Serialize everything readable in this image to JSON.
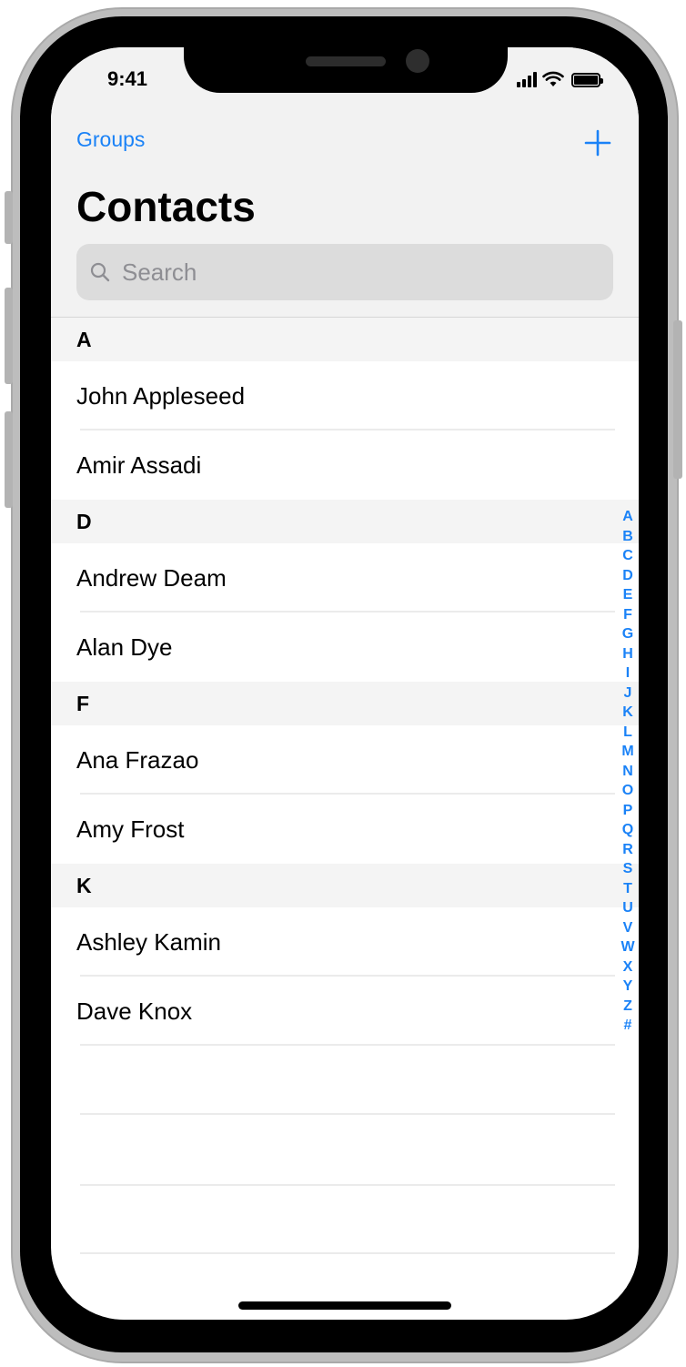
{
  "status_bar": {
    "time": "9:41"
  },
  "nav": {
    "left_label": "Groups",
    "title": "Contacts",
    "add_icon": "plus-icon"
  },
  "search": {
    "placeholder": "Search",
    "icon": "search-icon"
  },
  "sections": [
    {
      "letter": "A",
      "contacts": [
        "John Appleseed",
        "Amir Assadi"
      ]
    },
    {
      "letter": "D",
      "contacts": [
        "Andrew Deam",
        "Alan Dye"
      ]
    },
    {
      "letter": "F",
      "contacts": [
        "Ana Frazao",
        "Amy Frost"
      ]
    },
    {
      "letter": "K",
      "contacts": [
        "Ashley Kamin",
        "Dave Knox"
      ]
    }
  ],
  "index_letters": [
    "A",
    "B",
    "C",
    "D",
    "E",
    "F",
    "G",
    "H",
    "I",
    "J",
    "K",
    "L",
    "M",
    "N",
    "O",
    "P",
    "Q",
    "R",
    "S",
    "T",
    "U",
    "V",
    "W",
    "X",
    "Y",
    "Z",
    "#"
  ],
  "colors": {
    "accent": "#1a82f7",
    "header_bg": "#f2f2f2",
    "section_bg": "#f4f4f4",
    "search_bg": "#dcdcdc",
    "separator": "#ebebeb"
  }
}
